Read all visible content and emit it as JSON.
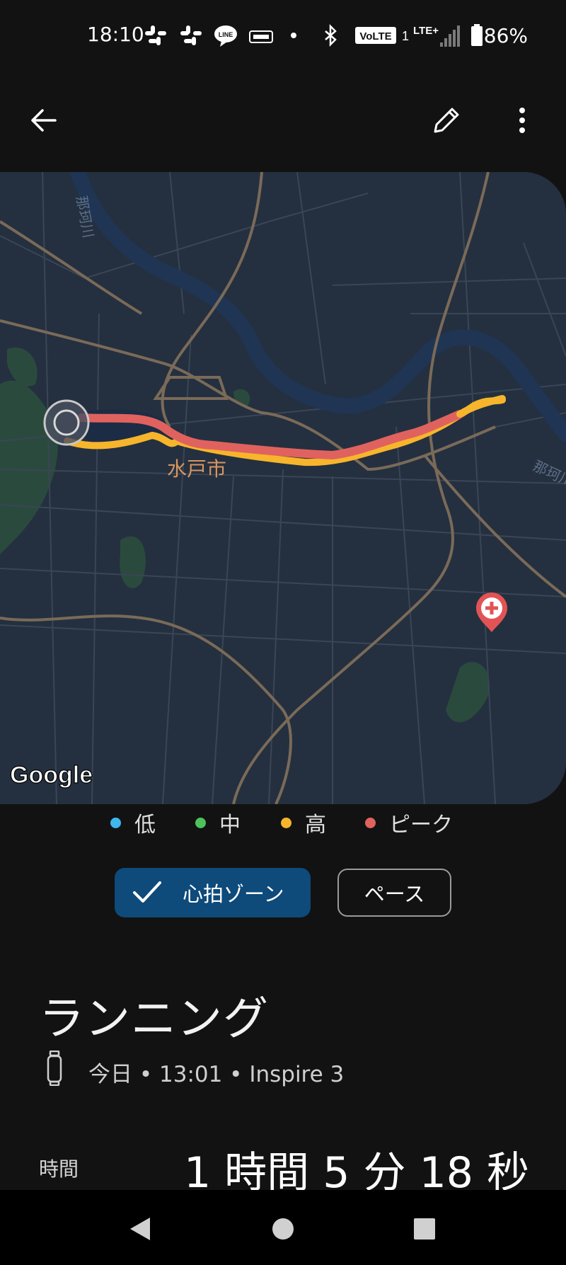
{
  "status_bar": {
    "time": "18:10",
    "battery": "86%",
    "network": "LTE+",
    "volte": "VoLTE",
    "sim": "1",
    "icons": [
      "slack-icon",
      "slack-icon",
      "line-icon",
      "wallet-icon",
      "dot-icon",
      "bluetooth-icon",
      "signal-icon",
      "battery-icon"
    ]
  },
  "app_bar": {
    "back_icon": "arrow-back-icon",
    "edit_icon": "pencil-icon",
    "more_icon": "more-vert-icon"
  },
  "map": {
    "attribution": "Google",
    "city_label": "水戸市",
    "river_label_top": "那珂川",
    "river_label_right": "那珂川",
    "start_marker_icon": "start-marker-icon",
    "hospital_icon": "hospital-pin-icon"
  },
  "legend": {
    "items": [
      {
        "label": "低",
        "color": "#3db7ee"
      },
      {
        "label": "中",
        "color": "#4cc35a"
      },
      {
        "label": "高",
        "color": "#f7b52c"
      },
      {
        "label": "ピーク",
        "color": "#e0625f"
      }
    ]
  },
  "chips": {
    "heart_rate_zone": "心拍ゾーン",
    "pace": "ペース"
  },
  "activity": {
    "title": "ランニング",
    "meta": "今日 • 13:01 • Inspire 3",
    "device_icon": "tracker-icon"
  },
  "duration": {
    "label": "時間",
    "value": "1 時間 5 分 18 秒"
  },
  "nav_bar": {
    "back_icon": "nav-back-icon",
    "home_icon": "nav-home-icon",
    "recents_icon": "nav-recents-icon"
  },
  "colors": {
    "background": "#121212",
    "map_bg": "#24303f",
    "route_high": "#f7b52c",
    "route_peak": "#e0625f",
    "chip_active": "#0e4a7a"
  }
}
